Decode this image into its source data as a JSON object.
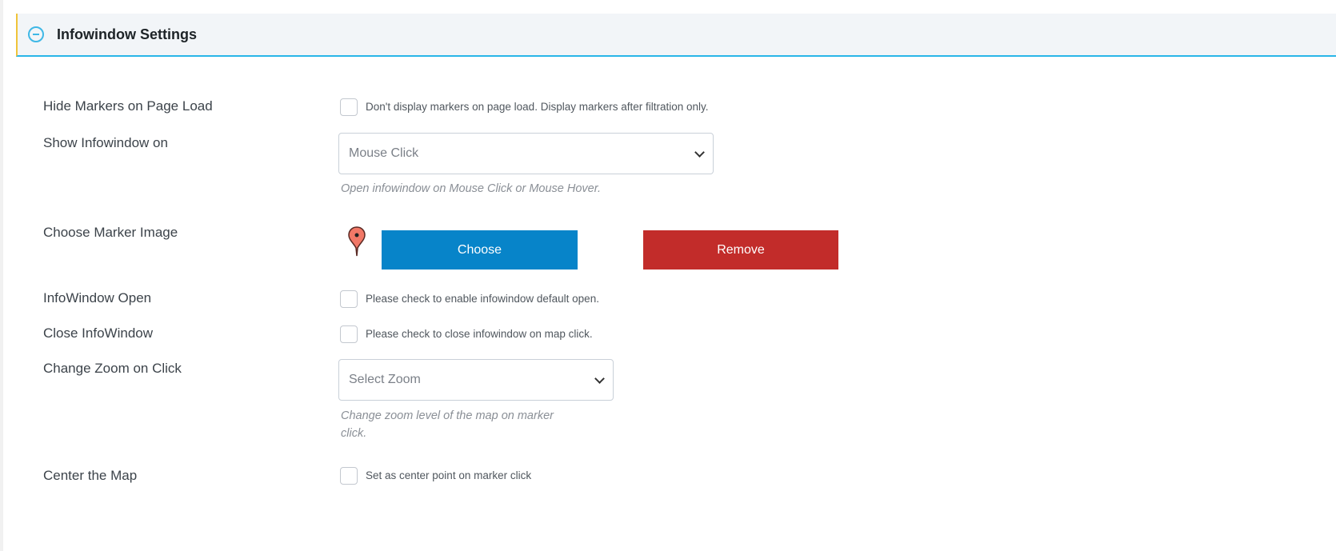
{
  "section": {
    "title": "Infowindow Settings",
    "icon": "collapse-minus-icon",
    "accent": "#29b6e8"
  },
  "fields": {
    "hide_markers": {
      "label": "Hide Markers on Page Load",
      "text": "Don't display markers on page load. Display markers after filtration only.",
      "checked": false
    },
    "show_infowindow": {
      "label": "Show Infowindow on",
      "value": "Mouse Click",
      "hint": "Open infowindow on Mouse Click or Mouse Hover."
    },
    "marker_image": {
      "label": "Choose Marker Image",
      "choose": "Choose",
      "remove": "Remove",
      "choose_color": "#0784c9",
      "remove_color": "#c22c2a"
    },
    "infowindow_open": {
      "label": "InfoWindow Open",
      "text": "Please check to enable infowindow default open.",
      "checked": false
    },
    "close_infowindow": {
      "label": "Close InfoWindow",
      "text": "Please check to close infowindow on map click.",
      "checked": false
    },
    "change_zoom": {
      "label": "Change Zoom on Click",
      "value": "Select Zoom",
      "hint_line1": "Change zoom level of the map on marker",
      "hint_line2": "click."
    },
    "center_map": {
      "label": "Center the Map",
      "text": "Set as center point on marker click",
      "checked": false
    }
  }
}
